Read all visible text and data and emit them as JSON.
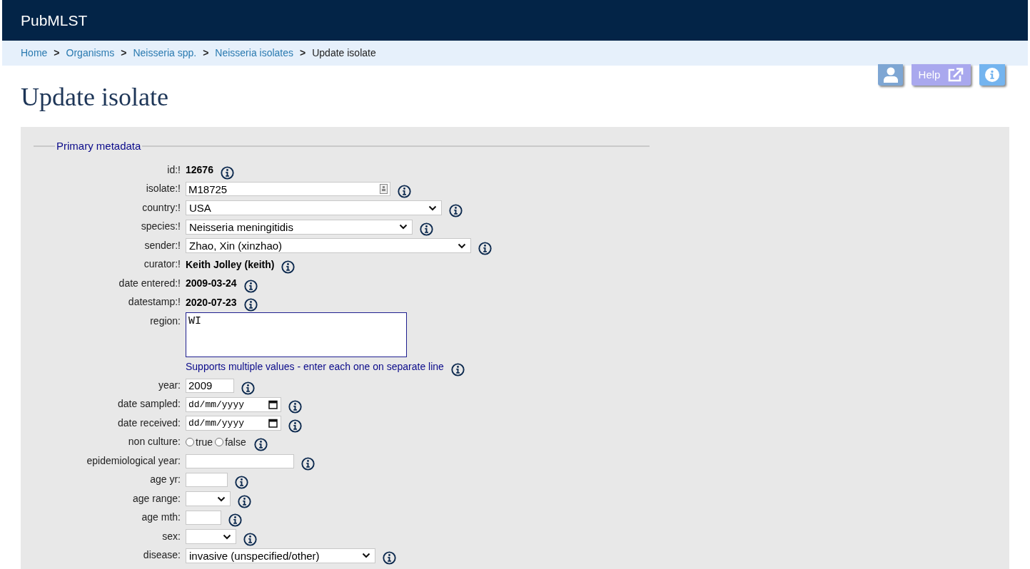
{
  "site": {
    "title": "PubMLST"
  },
  "breadcrumb": [
    {
      "label": "Home",
      "kind": "link"
    },
    {
      "label": "Organisms",
      "kind": "link"
    },
    {
      "label": "Neisseria spp.",
      "kind": "link"
    },
    {
      "label": "Neisseria isolates",
      "kind": "link"
    },
    {
      "label": "Update isolate",
      "kind": "current"
    }
  ],
  "breadcrumb_separator": ">",
  "toolbar": {
    "help_label": "Help"
  },
  "page_title": "Update isolate",
  "fieldset": {
    "legend": "Primary metadata",
    "rows": [
      {
        "label": "id:!",
        "kind": "text",
        "value": "12676"
      },
      {
        "label": "isolate:!",
        "kind": "input",
        "value": "M18725"
      },
      {
        "label": "country:!",
        "kind": "select",
        "value": "USA"
      },
      {
        "label": "species:!",
        "kind": "select",
        "value": "Neisseria meningitidis"
      },
      {
        "label": "sender:!",
        "kind": "select",
        "value": "Zhao, Xin (xinzhao)"
      },
      {
        "label": "curator:!",
        "kind": "text",
        "value": "Keith Jolley (keith)"
      },
      {
        "label": "date entered:!",
        "kind": "text",
        "value": "2009-03-24"
      },
      {
        "label": "datestamp:!",
        "kind": "text",
        "value": "2020-07-23"
      },
      {
        "label": "region:",
        "kind": "textarea",
        "value": "WI",
        "note": "Supports multiple values - enter each one on separate line"
      },
      {
        "label": "year:",
        "kind": "input",
        "value": "2009"
      },
      {
        "label": "date sampled:",
        "kind": "date",
        "placeholder": "dd/mm/yyyy"
      },
      {
        "label": "date received:",
        "kind": "date",
        "placeholder": "dd/mm/yyyy"
      },
      {
        "label": "non culture:",
        "kind": "radio",
        "options": [
          {
            "label": "true",
            "selected": false
          },
          {
            "label": "false",
            "selected": false
          }
        ]
      },
      {
        "label": "epidemiological year:",
        "kind": "input"
      },
      {
        "label": "age yr:",
        "kind": "input"
      },
      {
        "label": "age range:",
        "kind": "select"
      },
      {
        "label": "age mth:",
        "kind": "input"
      },
      {
        "label": "sex:",
        "kind": "select"
      },
      {
        "label": "disease:",
        "kind": "select",
        "value": "invasive (unspecified/other)"
      }
    ]
  }
}
